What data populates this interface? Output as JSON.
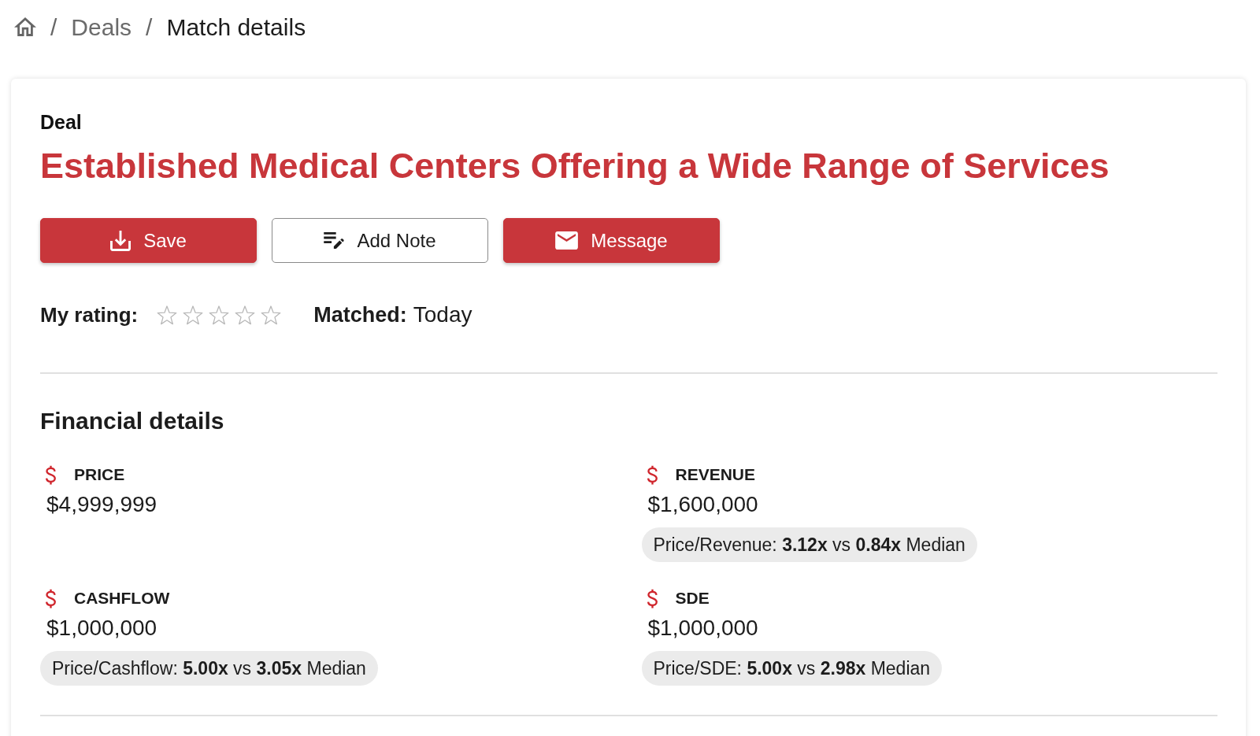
{
  "breadcrumb": [
    {
      "separator": "/",
      "label": "Deals",
      "current": false
    },
    {
      "separator": "/",
      "label": "Match details",
      "current": true
    }
  ],
  "deal": {
    "eyebrow": "Deal",
    "title": "Established Medical Centers Offering a Wide Range of Services"
  },
  "actions": [
    {
      "label": "Save",
      "kind": "filled"
    },
    {
      "label": "Add Note",
      "kind": "outlined"
    },
    {
      "label": "Message",
      "kind": "filled"
    }
  ],
  "rating": {
    "label": "My rating:",
    "stars": 0
  },
  "matched": {
    "label": "Matched:",
    "value": "Today"
  },
  "financial_details": {
    "title": "Financial details",
    "metrics": [
      {
        "label": "PRICE",
        "value": "$4,999,999"
      },
      {
        "label": "REVENUE",
        "value": "$1,600,000",
        "comparison": "Price/Revenue: **3.12x** vs **0.84x** Median"
      },
      {
        "label": "CASHFLOW",
        "value": "$1,000,000",
        "comparison": "Price/Cashflow: **5.00x** vs **3.05x** Median"
      },
      {
        "label": "SDE",
        "value": "$1,000,000",
        "comparison": "Price/SDE: **5.00x** vs **2.98x** Median"
      }
    ]
  }
}
